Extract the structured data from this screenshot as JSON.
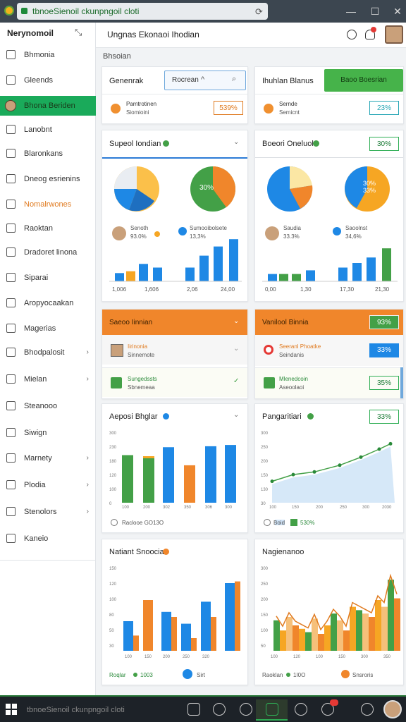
{
  "window": {
    "url": "tbnoeSienoil ckunpngoil cloti"
  },
  "sidebar": {
    "title": "Nerynomoil",
    "items": [
      {
        "label": "Bhmonia"
      },
      {
        "label": "Gleends"
      },
      {
        "label": "Bhona Beriden"
      },
      {
        "label": "Lanobnt"
      },
      {
        "label": "Blaronkans"
      },
      {
        "label": "Dneog esrienins"
      },
      {
        "label": "Nomalrwones"
      },
      {
        "label": "Raoktan"
      },
      {
        "label": "Dradoret linona"
      },
      {
        "label": "Siparai"
      },
      {
        "label": "Aropyocaakan"
      },
      {
        "label": "Magerias"
      },
      {
        "label": "Bhodpalosit"
      },
      {
        "label": "Mielan"
      },
      {
        "label": "Steanooo"
      },
      {
        "label": "Siwign"
      },
      {
        "label": "Marnety"
      },
      {
        "label": "Plodia"
      },
      {
        "label": "Stenolors"
      },
      {
        "label": "Kaneio"
      }
    ]
  },
  "header": {
    "title": "Ungnas Ekonaoi Ihodian"
  },
  "breadcrumb": "Bhsoian",
  "top": {
    "left": {
      "label": "Genenrak",
      "input": "Rocrean",
      "item_name": "Pamtrotinen",
      "item_sub": "Siomioini",
      "value": "539%"
    },
    "right": {
      "label": "Ihuhlan Blanus",
      "button": "Baoo Boesrian",
      "item_name": "Sernde",
      "item_sub": "Semicnt",
      "value": "23%"
    }
  },
  "p1": {
    "title": "Supeol Iondian",
    "pie_label": "30%",
    "p1_name": "Senoth",
    "p1_val": "93.0%",
    "p2_name": "Sumooibolsete",
    "p2_val": "13,3%",
    "axis": [
      "1,006",
      "1,606",
      "2,06",
      "24,00"
    ],
    "bars": [
      9,
      11,
      19,
      15,
      15,
      28,
      38,
      46
    ],
    "bar_colors": [
      "#1e88e5",
      "#f6a623",
      "#1e88e5",
      "#1e88e5",
      "#1e88e5",
      "#1e88e5",
      "#1e88e5",
      "#1e88e5"
    ]
  },
  "p2": {
    "title": "Boeori Oneluol",
    "badge": "30%",
    "pie_label": "30% 33%",
    "p1_name": "Saudia",
    "p1_val": "33.3%",
    "p2_name": "Saoolnst",
    "p2_val": "34,6%",
    "axis": [
      "0,00",
      "1,30",
      "17,30",
      "21,30"
    ],
    "bars": [
      8,
      8,
      8,
      12,
      15,
      20,
      26,
      36
    ],
    "bar_colors": [
      "#1e88e5",
      "#43a047",
      "#43a047",
      "#1e88e5",
      "#1e88e5",
      "#1e88e5",
      "#1e88e5",
      "#43a047"
    ]
  },
  "o1": {
    "header": "Saeoo Iinnian",
    "row1_name": "Iirinonia",
    "row1_sub": "Sinnemote",
    "row2_name": "Sungedssts",
    "row2_sub": "Sbnemeaa"
  },
  "o2": {
    "header": "Vanilool Binnia",
    "badge": "93%",
    "row1_name": "Seeranl Phoatke",
    "row1_sub": "Seindanis",
    "row1_val": "33%",
    "row2_name": "Mlenedcoin",
    "row2_sub": "Aseoolaoi",
    "row2_val": "35%"
  },
  "bar1": {
    "title": "Aeposi Bhglar",
    "yaxis": [
      "300",
      "230",
      "180",
      "120",
      "100",
      "0"
    ],
    "xaxis": [
      "100",
      "200",
      "302",
      "350",
      "306",
      "300"
    ],
    "footer": "Raclooe GO13O",
    "values": [
      150,
      140,
      175,
      118,
      178,
      182
    ]
  },
  "line1": {
    "title": "Pangaritiari",
    "badge": "33%",
    "yaxis": [
      "300",
      "250",
      "200",
      "150",
      "130",
      "30"
    ],
    "xaxis": [
      "100",
      "150",
      "200",
      "250",
      "300",
      "2030"
    ],
    "footer_a": "Boid",
    "footer_b": "530%",
    "values": [
      80,
      105,
      115,
      140,
      170,
      200,
      220
    ]
  },
  "bar2": {
    "title": "Natiant Snoocia",
    "yaxis": [
      "150",
      "120",
      "100",
      "80",
      "50",
      "30"
    ],
    "xaxis": [
      "100",
      "150",
      "200",
      "250",
      "320"
    ],
    "footer_a": "Roqlar",
    "footer_b": "1003",
    "footer_c": "Sirt",
    "blue": [
      35,
      0,
      46,
      32,
      58,
      80
    ],
    "orange": [
      18,
      60,
      40,
      15,
      40,
      82
    ]
  },
  "combo": {
    "title": "Nagienanoo",
    "yaxis": [
      "300",
      "250",
      "200",
      "150",
      "100",
      "50"
    ],
    "xaxis": [
      "100",
      "120",
      "100",
      "150",
      "300",
      "350"
    ],
    "footer_a": "Raoklan",
    "footer_b": "1I0O",
    "footer_c": "Snsroris"
  }
}
